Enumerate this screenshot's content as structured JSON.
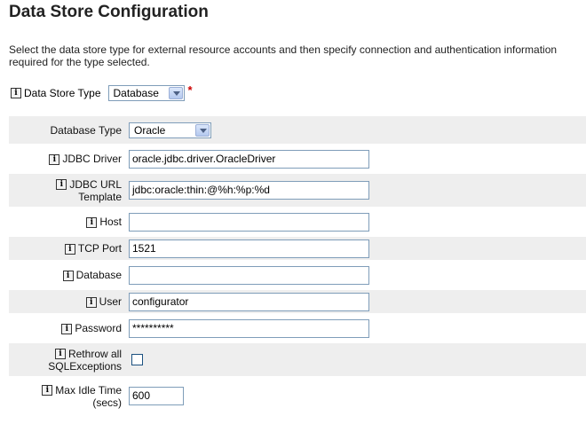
{
  "page": {
    "title": "Data Store Configuration",
    "description": "Select the data store type for external resource accounts and then specify connection and authentication information required for the type selected."
  },
  "data_store_type": {
    "label": "Data Store Type",
    "value": "Database",
    "required_marker": "*"
  },
  "fields": {
    "database_type": {
      "label": "Database Type",
      "value": "Oracle"
    },
    "jdbc_driver": {
      "label": "JDBC Driver",
      "value": "oracle.jdbc.driver.OracleDriver"
    },
    "jdbc_url_template": {
      "label_line1": "JDBC URL",
      "label_line2": "Template",
      "value": "jdbc:oracle:thin:@%h:%p:%d"
    },
    "host": {
      "label": "Host",
      "value": ""
    },
    "tcp_port": {
      "label": "TCP Port",
      "value": "1521"
    },
    "database": {
      "label": "Database",
      "value": ""
    },
    "user": {
      "label": "User",
      "value": "configurator"
    },
    "password": {
      "label": "Password",
      "value": "**********"
    },
    "rethrow": {
      "label_line1": "Rethrow all",
      "label_line2": "SQLExceptions",
      "checked": false
    },
    "max_idle_time": {
      "label_line1": "Max Idle Time",
      "label_line2": "(secs)",
      "value": "600"
    }
  },
  "icons": {
    "info": "i"
  }
}
